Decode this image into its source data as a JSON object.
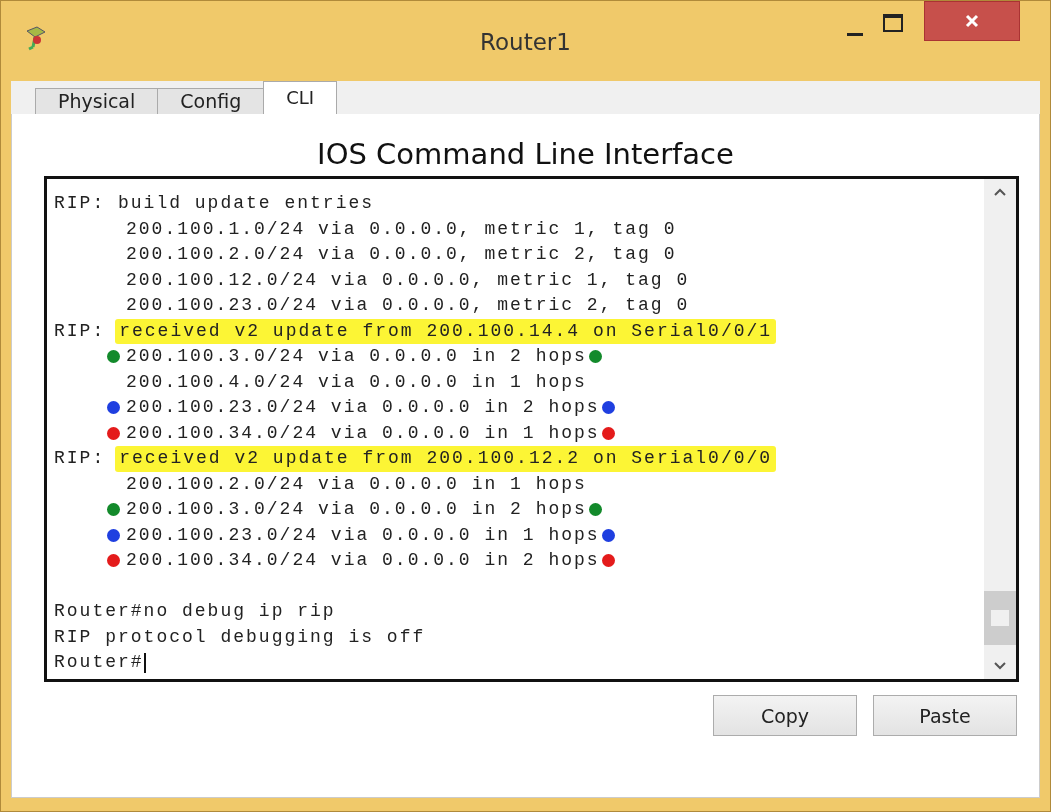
{
  "window": {
    "title": "Router1"
  },
  "tabs": [
    {
      "label": "Physical",
      "selected": false
    },
    {
      "label": "Config",
      "selected": false
    },
    {
      "label": "CLI",
      "selected": true
    }
  ],
  "heading": "IOS Command Line Interface",
  "console": {
    "lines": [
      {
        "kind": "log",
        "text": "RIP: build update entries"
      },
      {
        "kind": "entry",
        "text": "200.100.1.0/24 via 0.0.0.0, metric 1, tag 0"
      },
      {
        "kind": "entry",
        "text": "200.100.2.0/24 via 0.0.0.0, metric 2, tag 0"
      },
      {
        "kind": "entry",
        "text": "200.100.12.0/24 via 0.0.0.0, metric 1, tag 0"
      },
      {
        "kind": "entry",
        "text": "200.100.23.0/24 via 0.0.0.0, metric 2, tag 0"
      },
      {
        "kind": "highlighted",
        "prefix": "RIP:",
        "text": "received v2 update from 200.100.14.4 on Serial0/0/1"
      },
      {
        "kind": "entry",
        "text": "200.100.3.0/24 via 0.0.0.0 in 2 hops",
        "color": "#138a2b"
      },
      {
        "kind": "entry",
        "text": "200.100.4.0/24 via 0.0.0.0 in 1 hops"
      },
      {
        "kind": "entry",
        "text": "200.100.23.0/24 via 0.0.0.0 in 2 hops",
        "color": "#1f3fe0"
      },
      {
        "kind": "entry",
        "text": "200.100.34.0/24 via 0.0.0.0 in 1 hops",
        "color": "#e41b1b"
      },
      {
        "kind": "highlighted",
        "prefix": "RIP:",
        "text": "received v2 update from 200.100.12.2 on Serial0/0/0"
      },
      {
        "kind": "entry",
        "text": "200.100.2.0/24 via 0.0.0.0 in 1 hops"
      },
      {
        "kind": "entry",
        "text": "200.100.3.0/24 via 0.0.0.0 in 2 hops",
        "color": "#138a2b"
      },
      {
        "kind": "entry",
        "text": "200.100.23.0/24 via 0.0.0.0 in 1 hops",
        "color": "#1f3fe0"
      },
      {
        "kind": "entry",
        "text": "200.100.34.0/24 via 0.0.0.0 in 2 hops",
        "color": "#e41b1b"
      },
      {
        "kind": "blank"
      },
      {
        "kind": "log",
        "text": "Router#no debug ip rip"
      },
      {
        "kind": "log",
        "text": "RIP protocol debugging is off"
      },
      {
        "kind": "prompt",
        "text": "Router#"
      }
    ]
  },
  "buttons": [
    "Copy",
    "Paste"
  ]
}
